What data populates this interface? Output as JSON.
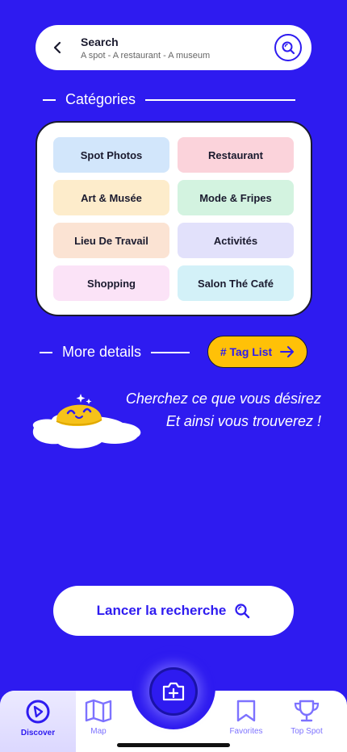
{
  "search": {
    "title": "Search",
    "subtitle": "A spot - A restaurant - A museum"
  },
  "categories_section": {
    "title": "Catégories"
  },
  "categories": [
    {
      "label": "Spot Photos",
      "color": "#D2E6FB"
    },
    {
      "label": "Restaurant",
      "color": "#FBD3DB"
    },
    {
      "label": "Art & Musée",
      "color": "#FDECCB"
    },
    {
      "label": "Mode & Fripes",
      "color": "#D3F3E0"
    },
    {
      "label": "Lieu De Travail",
      "color": "#FBE3D3"
    },
    {
      "label": "Activités",
      "color": "#E2E1FB"
    },
    {
      "label": "Shopping",
      "color": "#FBE3F7"
    },
    {
      "label": "Salon Thé Café",
      "color": "#D3F1F8"
    }
  ],
  "details_section": {
    "title": "More details"
  },
  "tag_button": {
    "label": "# Tag List"
  },
  "slogan": {
    "line1": "Cherchez ce que vous désirez",
    "line2": "Et ainsi vous trouverez !"
  },
  "launch_button": {
    "label": "Lancer la recherche"
  },
  "nav": {
    "discover": "Discover",
    "map": "Map",
    "favorites": "Favorites",
    "top_spot": "Top Spot"
  },
  "colors": {
    "background": "#2E1BF0",
    "accent_yellow": "#FFC107"
  }
}
